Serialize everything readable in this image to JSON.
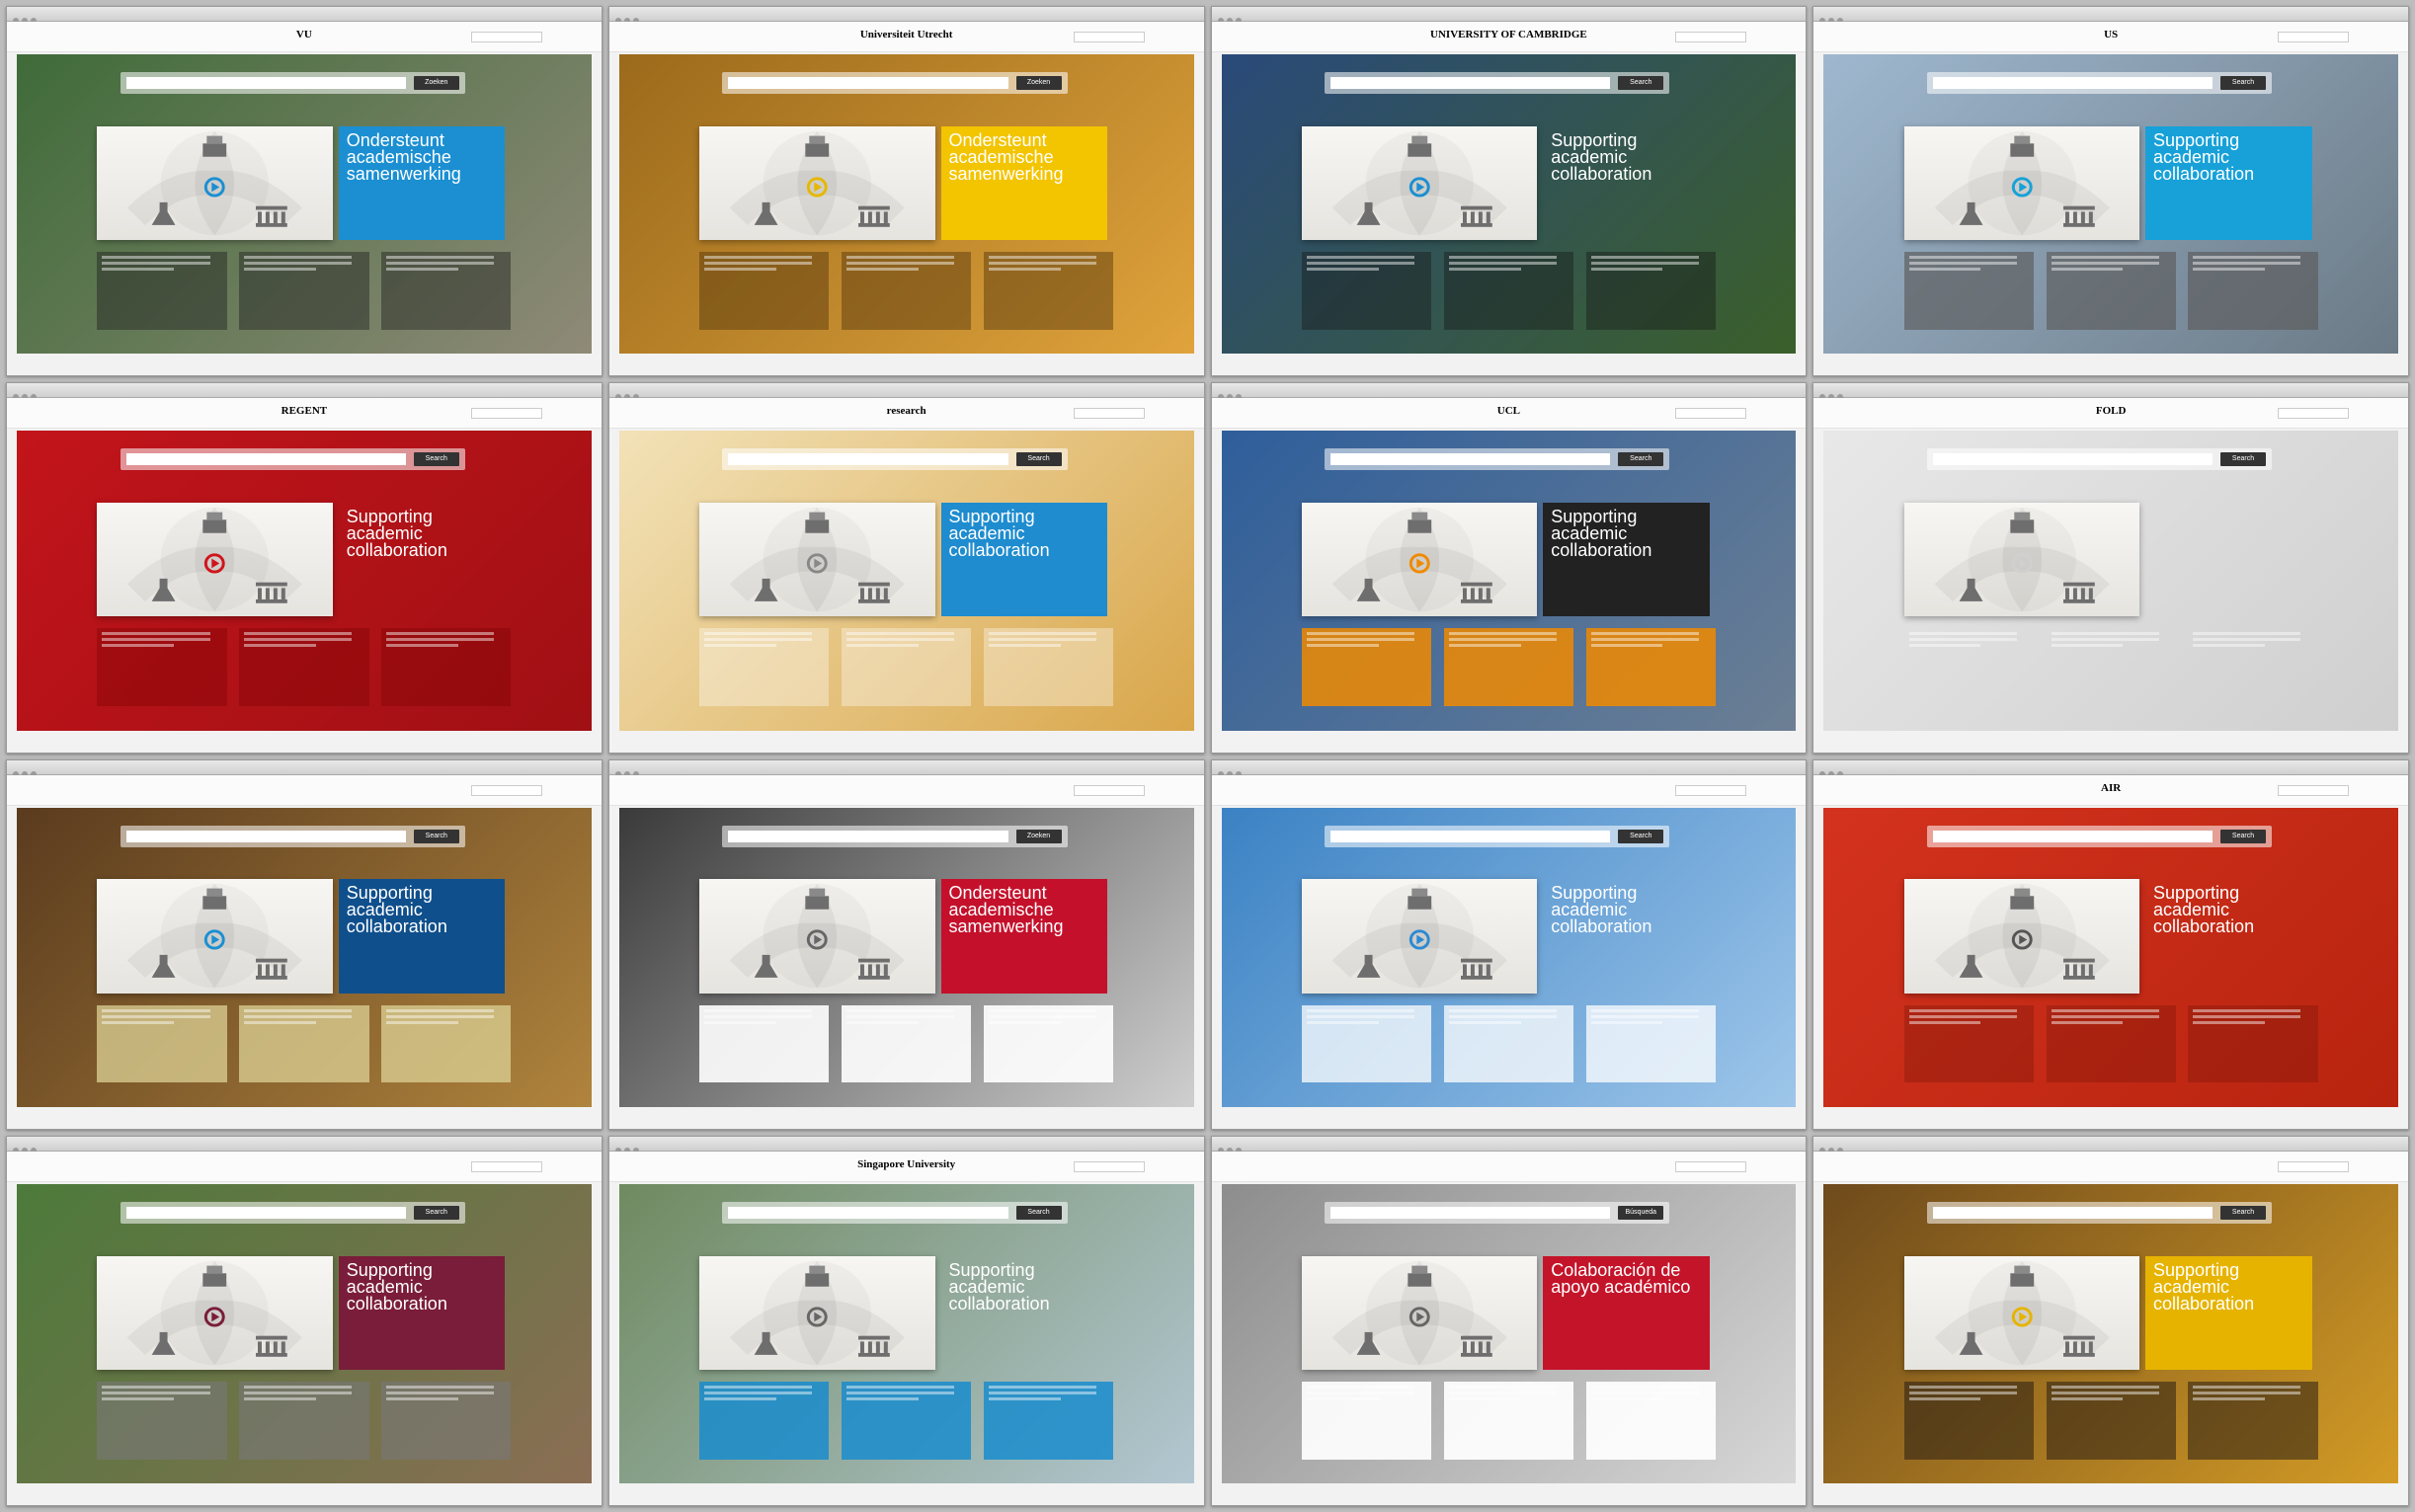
{
  "search_button": "Zoeken",
  "tiles": [
    {
      "logo": "VU",
      "claim": "Ondersteunt academische samenwerking",
      "claim_color": "#1b8fd2",
      "bg": [
        "#3f6b39",
        "#8f8a78"
      ],
      "accent": "#1b8fd2",
      "feature_bg": "rgba(30,30,30,0.45)",
      "button": "Zoeken"
    },
    {
      "logo": "Universiteit Utrecht",
      "claim": "Ondersteunt academische samenwerking",
      "claim_color": "#f3c400",
      "bg": [
        "#9b6a1b",
        "#e0a33c"
      ],
      "accent": "#e6b800",
      "feature_bg": "rgba(80,50,10,0.45)",
      "button": "Zoeken"
    },
    {
      "logo": "UNIVERSITY OF CAMBRIDGE",
      "claim": "Supporting academic collaboration",
      "claim_color": "rgba(255,255,255,0.0)",
      "bg": [
        "#2a4a7a",
        "#3b5f2a"
      ],
      "accent": "#1b8fd2",
      "feature_bg": "rgba(20,20,20,0.4)",
      "button": "Search"
    },
    {
      "logo": "US",
      "claim": "Supporting academic collaboration",
      "claim_color": "#17a1d8",
      "bg": [
        "#9fb8cf",
        "#6b7a86"
      ],
      "accent": "#17a1d8",
      "feature_bg": "rgba(90,90,90,0.65)",
      "button": "Search"
    },
    {
      "logo": "REGENT",
      "claim": "Supporting academic collaboration",
      "claim_color": "rgba(255,255,255,0.0)",
      "bg": [
        "#c2141b",
        "#a01014"
      ],
      "accent": "#d0141b",
      "feature_bg": "rgba(120,0,0,0.35)",
      "button": "Search"
    },
    {
      "logo": "research",
      "claim": "Supporting academic collaboration",
      "claim_color": "#1e8ccf",
      "bg": [
        "#f2e2b8",
        "#d9a64a"
      ],
      "accent": "#888",
      "feature_bg": "rgba(255,255,255,0.35)",
      "button": "Search"
    },
    {
      "logo": "UCL",
      "claim": "Supporting academic collaboration",
      "claim_color": "#222",
      "bg": [
        "#2e5e9b",
        "#6c7f94"
      ],
      "accent": "#f08a00",
      "feature_bg": "rgba(240,138,0,0.85)",
      "button": "Search"
    },
    {
      "logo": "FOLD",
      "claim": "",
      "claim_color": "rgba(255,255,255,0.0)",
      "bg": [
        "#e8e8e8",
        "#cfcfcf"
      ],
      "accent": "#d0d0d0",
      "feature_bg": "rgba(255,255,255,0.0)",
      "button": "Search"
    },
    {
      "logo": "",
      "claim": "Supporting academic collaboration",
      "claim_color": "#0f4f8c",
      "bg": [
        "#5a3b1e",
        "#b0843d"
      ],
      "accent": "#1b8fd2",
      "feature_bg": "rgba(220,210,150,0.75)",
      "button": "Search"
    },
    {
      "logo": "",
      "claim": "Ondersteunt academische samenwerking",
      "claim_color": "#c4102b",
      "bg": [
        "#3a3a3a",
        "#cfcfcf"
      ],
      "accent": "#666",
      "feature_bg": "rgba(255,255,255,0.9)",
      "button": "Zoeken"
    },
    {
      "logo": "",
      "claim": "Supporting academic collaboration",
      "claim_color": "rgba(255,255,255,0.0)",
      "bg": [
        "#3b82c4",
        "#9ec6ea"
      ],
      "accent": "#2d8ad3",
      "feature_bg": "rgba(255,255,255,0.75)",
      "button": "Search"
    },
    {
      "logo": "AIR",
      "claim": "Supporting academic collaboration",
      "claim_color": "rgba(255,255,255,0.0)",
      "bg": [
        "#d3321e",
        "#b8240f"
      ],
      "accent": "#555",
      "feature_bg": "rgba(120,20,10,0.35)",
      "button": "Search"
    },
    {
      "logo": "",
      "claim": "Supporting academic collaboration",
      "claim_color": "#7a1d3a",
      "bg": [
        "#4c7a3b",
        "#8b6e54"
      ],
      "accent": "#7a1d3a",
      "feature_bg": "rgba(120,120,120,0.6)",
      "button": "Search"
    },
    {
      "logo": "Singapore University",
      "claim": "Supporting academic collaboration",
      "claim_color": "rgba(40,40,40,0.0)",
      "bg": [
        "#6f8a60",
        "#b3c7d2"
      ],
      "accent": "#666",
      "feature_bg": "rgba(25,140,205,0.85)",
      "button": "Search"
    },
    {
      "logo": "",
      "claim": "Colaboración de apoyo académico",
      "claim_color": "#c4142a",
      "bg": [
        "#8d8d8d",
        "#d7d7d7"
      ],
      "accent": "#666",
      "feature_bg": "rgba(255,255,255,0.92)",
      "button": "Búsqueda"
    },
    {
      "logo": "",
      "claim": "Supporting academic collaboration",
      "claim_color": "#e6b400",
      "bg": [
        "#6e4a1c",
        "#d39b25"
      ],
      "accent": "#e6b400",
      "feature_bg": "rgba(40,30,20,0.55)",
      "button": "Search"
    }
  ]
}
